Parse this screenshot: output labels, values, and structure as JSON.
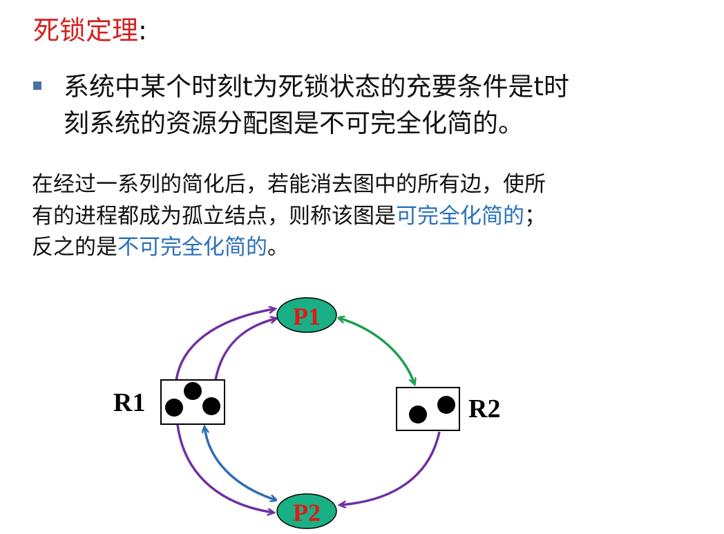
{
  "title": {
    "main": "死锁定理",
    "colon": ":"
  },
  "bullet": {
    "line1": "系统中某个时刻t为死锁状态的充要条件是t时",
    "line2": "刻系统的资源分配图是不可完全化简的。"
  },
  "paragraph": {
    "line1": "在经过一系列的简化后，若能消去图中的所有边，使所",
    "line2_pre": "有的进程都成为孤立结点，则称该图是",
    "line2_blue": "可完全化简的",
    "line2_post": "；",
    "line3_pre": "反之的是",
    "line3_blue": "不可完全化简的",
    "line3_post": "。"
  },
  "diagram": {
    "process_p1": "P1",
    "process_p2": "P2",
    "resource_r1": "R1",
    "resource_r2": "R2",
    "r1_instances": 3,
    "r2_instances": 2
  },
  "colors": {
    "title_red": "#d4201f",
    "highlight_blue": "#2a70b8",
    "process_fill": "#1aaf84",
    "process_label": "#e31818",
    "purple_edge": "#7030a0",
    "green_edge": "#1aa04a",
    "blue_edge": "#2e6db4"
  }
}
